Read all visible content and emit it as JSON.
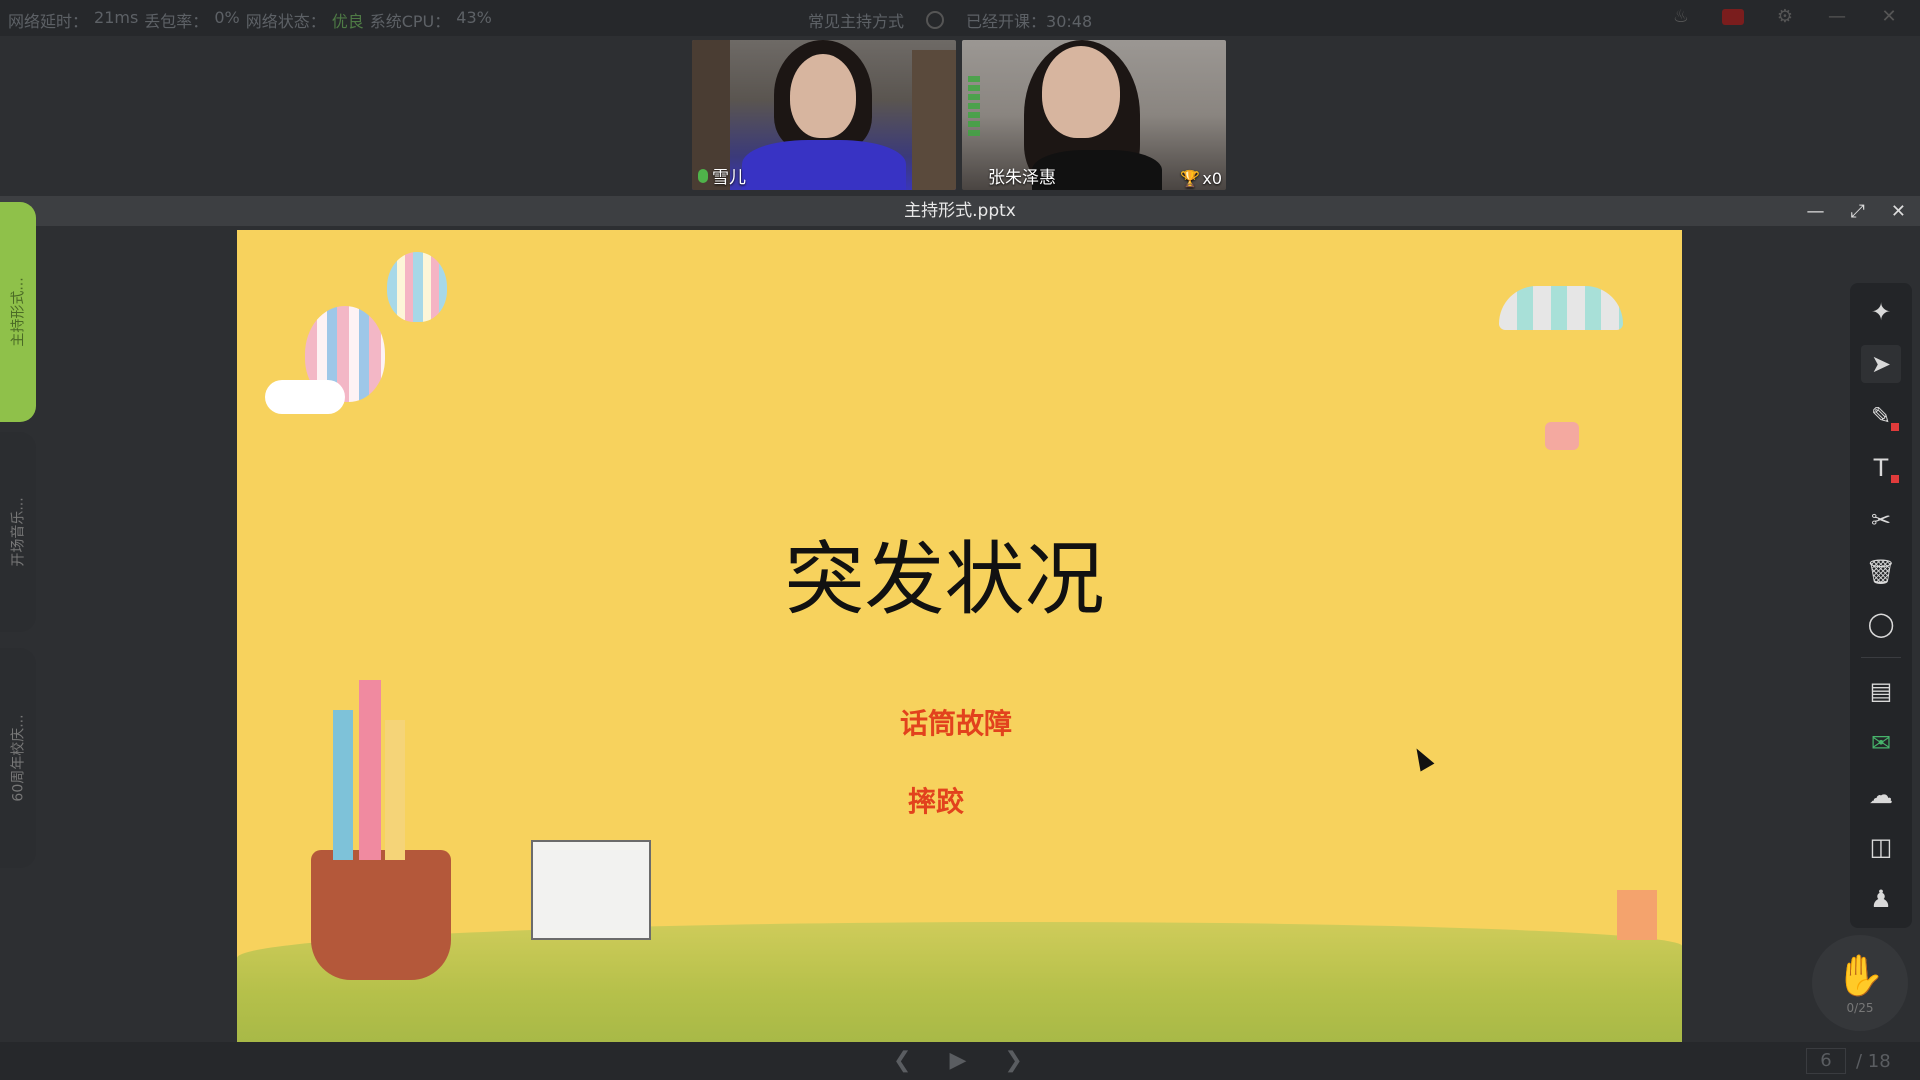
{
  "status": {
    "latency_label": "网络延时：",
    "latency_value": "21ms",
    "loss_label": "丢包率：",
    "loss_value": "0%",
    "net_label": "网络状态：",
    "net_value": "优良",
    "cpu_label": "系统CPU：",
    "cpu_value": "43%",
    "course_title": "常见主持方式",
    "elapsed_label": "已经开课：",
    "elapsed_value": "30:48"
  },
  "participants": [
    {
      "name": "雪儿"
    },
    {
      "name": "张朱泽惠",
      "trophies": "x0"
    }
  ],
  "document": {
    "filename": "主持形式.pptx"
  },
  "side_tabs": [
    {
      "label": "主持形式..."
    },
    {
      "label": "开场音乐..."
    },
    {
      "label": "60周年校庆..."
    }
  ],
  "slide": {
    "title": "突发状况",
    "items": [
      "话筒故障",
      "摔跤"
    ]
  },
  "toolbar": {
    "tools": [
      "laser-pointer",
      "select-move",
      "pen",
      "text",
      "scissors",
      "delete",
      "shapes",
      "textbox",
      "chat",
      "cloud",
      "toolbox",
      "members"
    ]
  },
  "hand": {
    "count": "0/25"
  },
  "pager": {
    "current": "6",
    "total": "/ 18"
  },
  "colors": {
    "slide_bg": "#f7d25d",
    "accent_green": "#8fc14a",
    "item_red": "#e2421d"
  }
}
